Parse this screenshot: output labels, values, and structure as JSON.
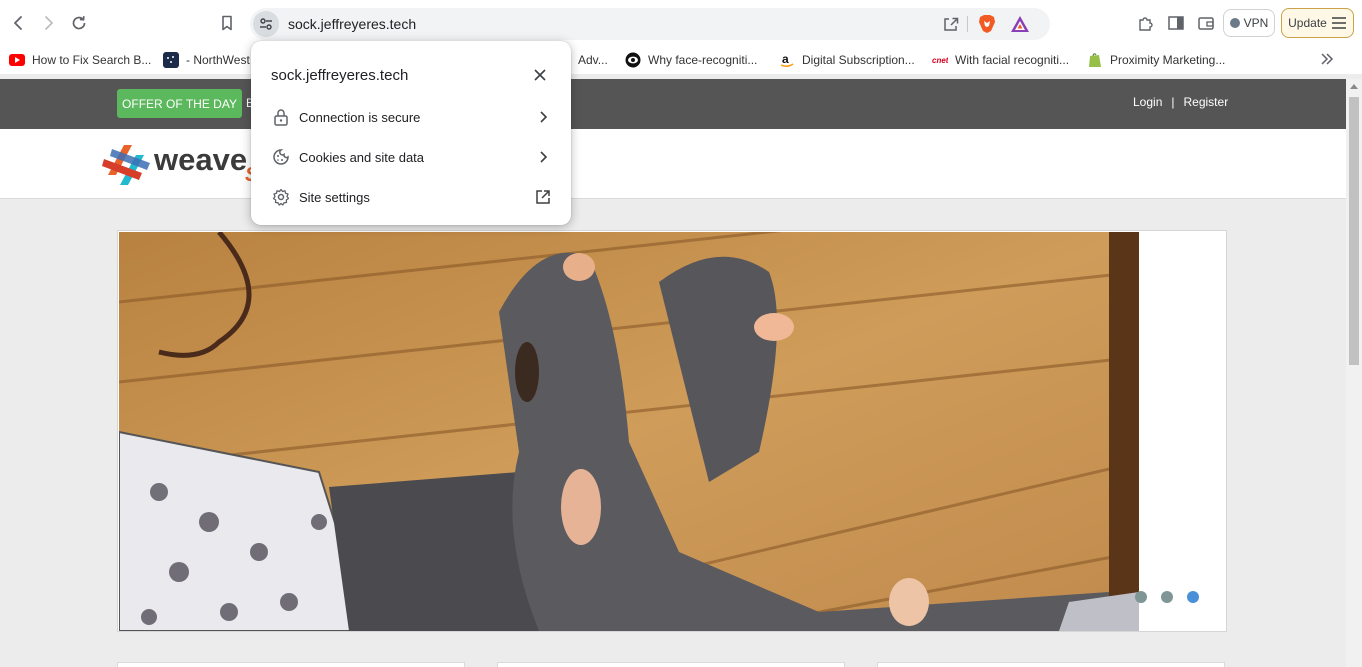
{
  "browser": {
    "url": "sock.jeffreyeres.tech",
    "vpn_label": "VPN",
    "update_label": "Update",
    "bookmarks": [
      {
        "label": "How to Fix Search B...",
        "icon": "youtube-icon"
      },
      {
        "label": "- NorthWest",
        "icon": "northwest-icon"
      },
      {
        "label": "Adv...",
        "icon": "generic-icon"
      },
      {
        "label": "Why face-recogniti...",
        "icon": "eye-icon"
      },
      {
        "label": "Digital Subscription...",
        "icon": "amazon-icon"
      },
      {
        "label": "With facial recogniti...",
        "icon": "cnet-icon"
      },
      {
        "label": "Proximity Marketing...",
        "icon": "shopify-icon"
      }
    ]
  },
  "site_info_popup": {
    "title": "sock.jeffreyeres.tech",
    "rows": [
      {
        "label": "Connection is secure",
        "icon": "lock-icon"
      },
      {
        "label": "Cookies and site data",
        "icon": "cookie-icon"
      },
      {
        "label": "Site settings",
        "icon": "gear-icon"
      }
    ]
  },
  "page": {
    "offer_label": "OFFER OF THE DAY",
    "offer_partial": "B",
    "login_label": "Login",
    "separator": "|",
    "register_label": "Register",
    "logo_text": "weave",
    "logo_sub": "S",
    "carousel": {
      "slide_count": 3,
      "active_slide": 3
    }
  },
  "colors": {
    "topbar": "#555555",
    "offer_green": "#5cb85c",
    "dot_inactive": "#7f9696",
    "dot_active": "#4a90d9",
    "logo_orange": "#e8622a"
  }
}
